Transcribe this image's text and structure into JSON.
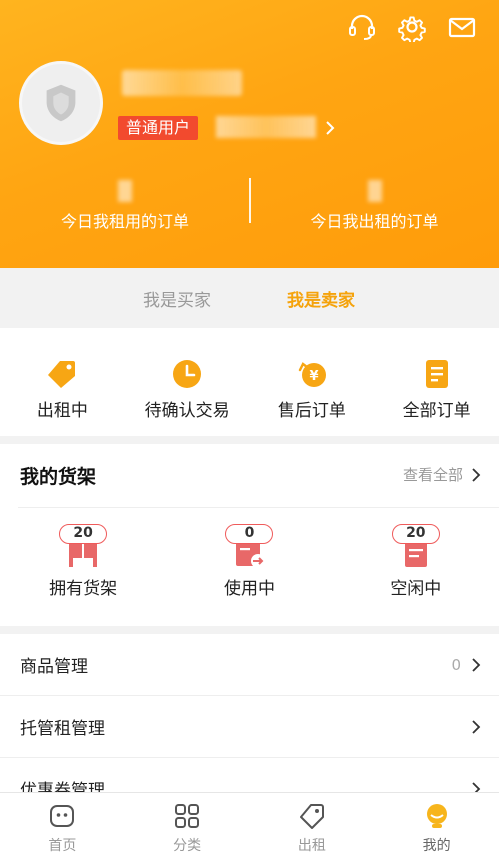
{
  "header": {
    "icons": [
      "headset-icon",
      "gear-icon",
      "mail-icon"
    ],
    "badge": "普通用户",
    "stats": [
      {
        "label": "今日我租用的订单"
      },
      {
        "label": "今日我出租的订单"
      }
    ]
  },
  "role_tabs": [
    {
      "label": "我是买家",
      "active": false
    },
    {
      "label": "我是卖家",
      "active": true
    }
  ],
  "orders": [
    {
      "label": "出租中",
      "icon": "tag-icon"
    },
    {
      "label": "待确认交易",
      "icon": "clock-icon"
    },
    {
      "label": "售后订单",
      "icon": "yen-coin-icon"
    },
    {
      "label": "全部订单",
      "icon": "document-icon"
    }
  ],
  "shelf": {
    "title": "我的货架",
    "view_all": "查看全部",
    "items": [
      {
        "label": "拥有货架",
        "count": "20"
      },
      {
        "label": "使用中",
        "count": "0"
      },
      {
        "label": "空闲中",
        "count": "20"
      }
    ]
  },
  "menu": [
    {
      "label": "商品管理",
      "count": "0"
    },
    {
      "label": "托管租管理",
      "count": ""
    },
    {
      "label": "优惠券管理",
      "count": ""
    }
  ],
  "nav": [
    {
      "label": "首页",
      "icon": "home-icon"
    },
    {
      "label": "分类",
      "icon": "grid-icon"
    },
    {
      "label": "出租",
      "icon": "tag-icon"
    },
    {
      "label": "我的",
      "icon": "profile-icon",
      "active": true
    }
  ],
  "colors": {
    "accent": "#ffa512",
    "badge": "#f24a2e",
    "icon_orange": "#f7a614",
    "counter_border": "#ef5b5b"
  }
}
